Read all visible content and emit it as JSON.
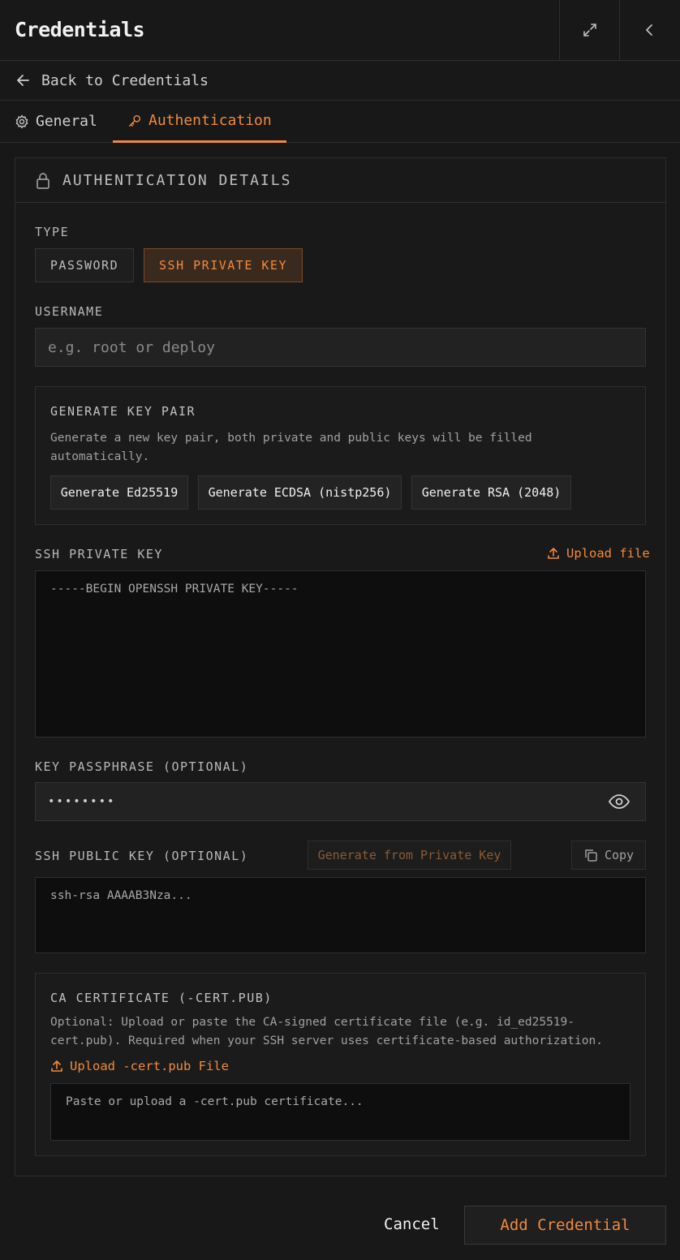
{
  "header": {
    "title": "Credentials"
  },
  "back": {
    "label": "Back to Credentials"
  },
  "tabs": [
    {
      "label": "General"
    },
    {
      "label": "Authentication"
    }
  ],
  "section": {
    "title": "AUTHENTICATION DETAILS"
  },
  "type": {
    "label": "TYPE",
    "options": [
      "PASSWORD",
      "SSH PRIVATE KEY"
    ],
    "selected": "SSH PRIVATE KEY"
  },
  "username": {
    "label": "USERNAME",
    "placeholder": "e.g. root or deploy",
    "value": ""
  },
  "generate": {
    "title": "GENERATE KEY PAIR",
    "desc_line1": "Generate a new key pair, both private and public keys will be filled",
    "desc_line2": "automatically.",
    "buttons": [
      "Generate Ed25519",
      "Generate ECDSA (nistp256)",
      "Generate RSA (2048)"
    ]
  },
  "private_key": {
    "label": "SSH PRIVATE KEY",
    "upload": "Upload file",
    "placeholder": "-----BEGIN OPENSSH PRIVATE KEY-----"
  },
  "passphrase": {
    "label": "KEY PASSPHRASE (OPTIONAL)",
    "masked": "••••••••"
  },
  "public_key": {
    "label": "SSH PUBLIC KEY (OPTIONAL)",
    "generate": "Generate from Private Key",
    "copy": "Copy",
    "placeholder": "ssh-rsa AAAAB3Nza..."
  },
  "ca_cert": {
    "title": "CA CERTIFICATE (-CERT.PUB)",
    "desc_line1": "Optional: Upload or paste the CA-signed certificate file (e.g. id_ed25519-",
    "desc_line2": "cert.pub). Required when your SSH server uses certificate-based authorization.",
    "upload": "Upload -cert.pub File",
    "placeholder": "Paste or upload a -cert.pub certificate..."
  },
  "footer": {
    "cancel": "Cancel",
    "submit": "Add Credential"
  },
  "colors": {
    "accent": "#f08a3c",
    "background": "#181818",
    "border": "#2e2e2e"
  },
  "icons": [
    "expand-icon",
    "chevron-left-icon",
    "arrow-left-icon",
    "gear-icon",
    "key-icon",
    "lock-icon",
    "upload-icon",
    "eye-icon",
    "copy-icon"
  ]
}
